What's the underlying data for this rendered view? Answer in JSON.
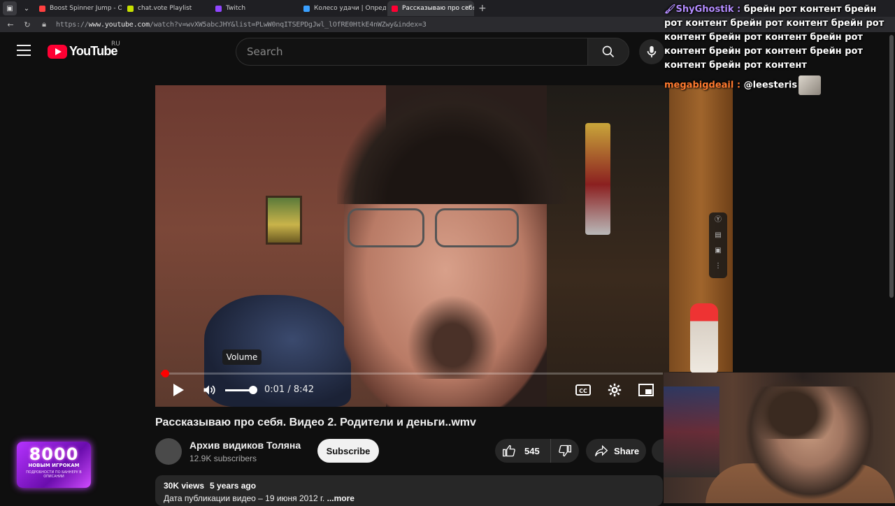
{
  "browser": {
    "tabs": [
      {
        "label": "Boost Spinner Jump - One",
        "color": "#ff4040",
        "active": false
      },
      {
        "label": "chat.vote Playlist",
        "color": "#c7e000",
        "active": false
      },
      {
        "label": "Twitch",
        "color": "#9146ff",
        "active": false
      },
      {
        "label": "Колесо удачи | Определ",
        "color": "#3aa0ff",
        "active": false
      },
      {
        "label": "Рассказываю про себя",
        "color": "#ff0033",
        "active": true
      }
    ],
    "url_prefix": "https://",
    "url_host": "www.youtube.com",
    "url_path": "/watch?v=wvXW5abcJHY&list=PLwW0nqITSEPDgJwl_lOfRE0HtkE4nWZwy&index=3"
  },
  "header": {
    "logo_text": "YouTube",
    "region": "RU",
    "search_placeholder": "Search"
  },
  "player": {
    "volume_tooltip": "Volume",
    "time_current": "0:01",
    "time_separator": " / ",
    "time_total": "8:42",
    "progress_fraction": 0.002,
    "volume_fraction": 0.95
  },
  "video": {
    "title": "Рассказываю про себя. Видео 2. Родители и деньги..wmv",
    "channel_name": "Архив видиков Толяна",
    "subscribers": "12.9K subscribers",
    "subscribe_label": "Subscribe",
    "likes": "545",
    "share_label": "Share",
    "views": "30K views",
    "age": "5 years ago",
    "description_line": "Дата публикации видео – 19 июня 2012 г. ",
    "more_label": "...more"
  },
  "promo": {
    "big": "8000",
    "mid": "НОВЫМ ИГРОКАМ",
    "small": "ПОДРОБНОСТИ ПО БАННЕРУ В ОПИСАНИИ"
  },
  "chat": {
    "messages": [
      {
        "user": "ShyGhostik",
        "text": "брейн рот контент брейн рот контент брейн рот контент брейн рот контент брейн рот контент брейн рот контент брейн рот контент брейн рот контент брейн рот контент"
      },
      {
        "user": "megabigdeail",
        "text": "@leesteris"
      }
    ]
  },
  "colors": {
    "youtube_red": "#ff0033",
    "chat_user1": "#b48cff",
    "chat_user2": "#ff7a2f"
  }
}
